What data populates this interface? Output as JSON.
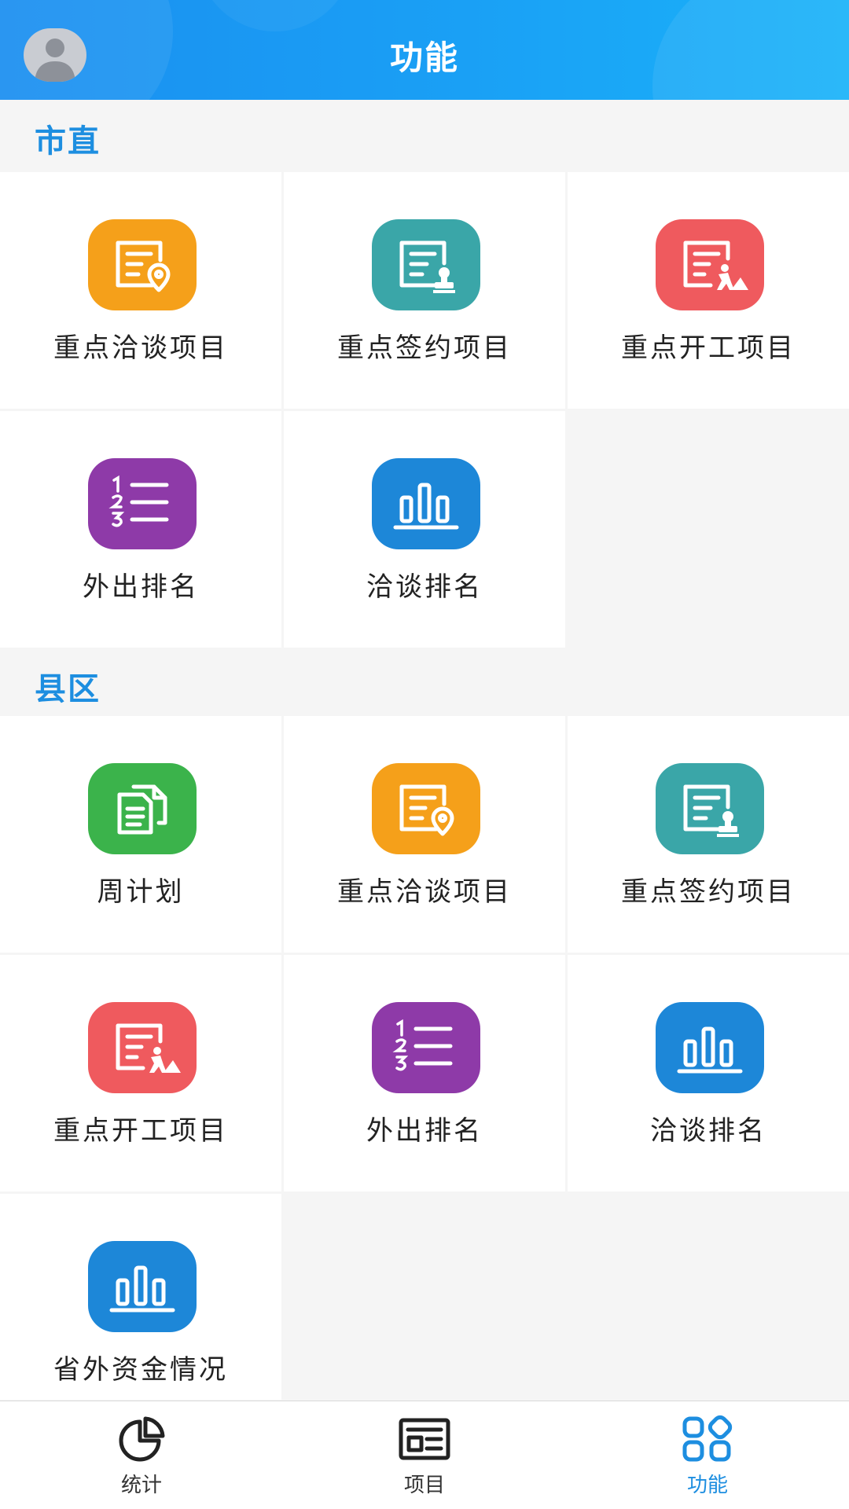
{
  "header": {
    "title": "功能"
  },
  "sections": [
    {
      "title": "市直",
      "items": [
        {
          "label": "重点洽谈项目",
          "icon": "doc-location-icon",
          "color": "#f5a01a"
        },
        {
          "label": "重点签约项目",
          "icon": "doc-stamp-icon",
          "color": "#3aa6a8"
        },
        {
          "label": "重点开工项目",
          "icon": "doc-worker-icon",
          "color": "#ef5a5e"
        },
        {
          "label": "外出排名",
          "icon": "numbered-list-icon",
          "color": "#8e3aa8"
        },
        {
          "label": "洽谈排名",
          "icon": "bar-chart-icon",
          "color": "#1d87d8"
        }
      ]
    },
    {
      "title": "县区",
      "items": [
        {
          "label": "周计划",
          "icon": "documents-icon",
          "color": "#3bb34b"
        },
        {
          "label": "重点洽谈项目",
          "icon": "doc-location-icon",
          "color": "#f5a01a"
        },
        {
          "label": "重点签约项目",
          "icon": "doc-stamp-icon",
          "color": "#3aa6a8"
        },
        {
          "label": "重点开工项目",
          "icon": "doc-worker-icon",
          "color": "#ef5a5e"
        },
        {
          "label": "外出排名",
          "icon": "numbered-list-icon",
          "color": "#8e3aa8"
        },
        {
          "label": "洽谈排名",
          "icon": "bar-chart-icon",
          "color": "#1d87d8"
        },
        {
          "label": "省外资金情况",
          "icon": "bar-chart-icon",
          "color": "#1d87d8"
        }
      ]
    }
  ],
  "tabbar": [
    {
      "label": "统计",
      "icon": "pie-chart-icon",
      "active": false
    },
    {
      "label": "项目",
      "icon": "newspaper-icon",
      "active": false
    },
    {
      "label": "功能",
      "icon": "apps-grid-icon",
      "active": true
    }
  ],
  "colors": {
    "accent": "#1d8ee0",
    "header": "#1a8ff0"
  }
}
